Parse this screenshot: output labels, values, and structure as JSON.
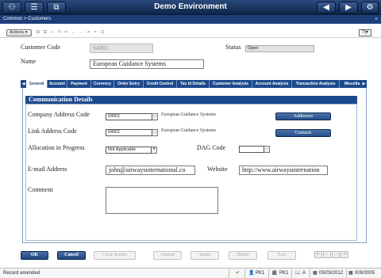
{
  "window": {
    "title": "Demo Environment"
  },
  "breadcrumb": {
    "text": "Common > Customers",
    "close": "×"
  },
  "toolbar": {
    "actions_label": "Actions ▾",
    "help_label": "?|▾",
    "icons": [
      "⊞",
      "⧉",
      "⌕",
      "⟲",
      "⇤",
      "←",
      "→",
      "⇥",
      "⌖",
      "⊡"
    ]
  },
  "header": {
    "customer_code_label": "Customer Code",
    "customer_code_value": "64001",
    "status_label": "Status",
    "status_value": "Open",
    "name_label": "Name",
    "name_value": "European Guidance Systems"
  },
  "tabs": [
    "General",
    "Account",
    "Payment",
    "Currency",
    "Order Entry",
    "Credit Control",
    "Tax Id Details",
    "Customer Analysis",
    "Account Analysis",
    "Transaction Analysis",
    "Miscella"
  ],
  "active_tab": "General",
  "section": {
    "title": "Communication Details"
  },
  "form": {
    "company_address_code_label": "Company Address Code",
    "company_address_code_value": "64001",
    "company_address_desc": "European Guidance Systems",
    "addresses_button": "Addresses",
    "link_address_code_label": "Link Address Code",
    "link_address_code_value": "64001",
    "link_address_desc": "European Guidance Systems",
    "contacts_button": "Contacts",
    "allocation_label": "Allocation in Progress",
    "allocation_value": "Not Applicable",
    "dag_code_label": "DAG Code",
    "dag_code_value": "",
    "email_label": "E-mail Address",
    "email_value": "john@airwaysinternational.co",
    "website_label": "Website",
    "website_value": "http://www.airwaysinternation",
    "comment_label": "Comment",
    "comment_value": ""
  },
  "footer_buttons": {
    "ok": "OK",
    "cancel": "Cancel",
    "clear": "Clear Screen",
    "amend": "Amend",
    "insert": "Insert",
    "delete": "Delete",
    "exit": "Exit"
  },
  "status_bar": {
    "message": "Record amended",
    "check": "✔",
    "user": "PK1",
    "company": "PK1",
    "lang": "A",
    "date": "05/03/2012",
    "period": "009/2005"
  },
  "colors": {
    "navy": "#1d4a8e",
    "topbar": "#1a365f"
  }
}
